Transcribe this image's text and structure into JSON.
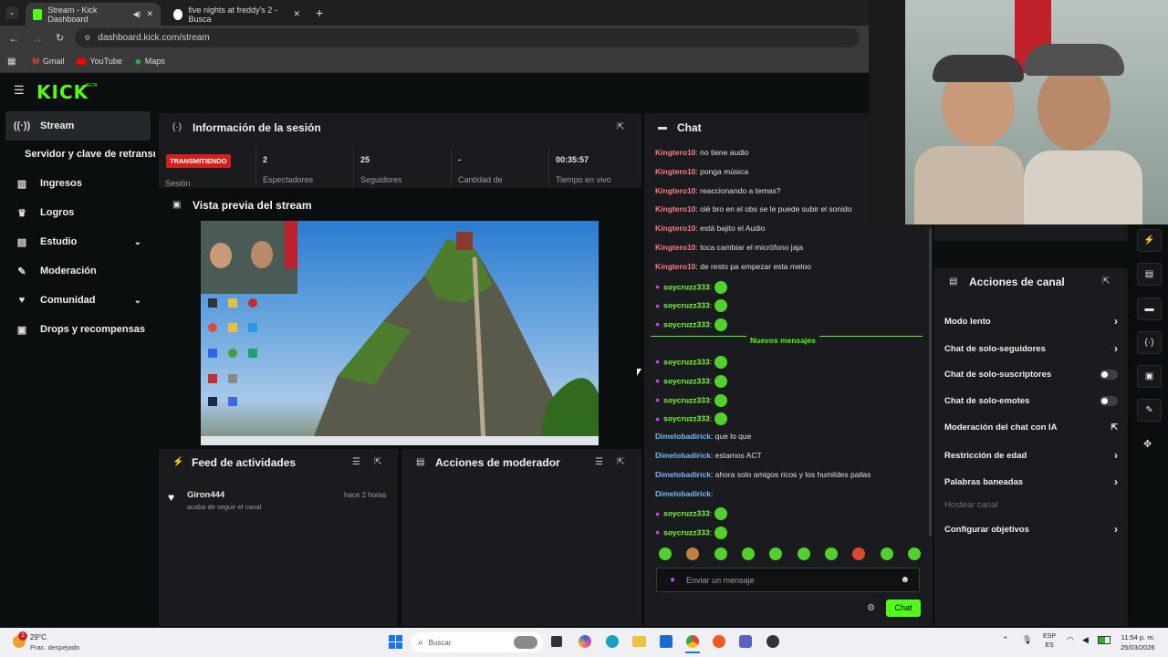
{
  "browser": {
    "tabs": [
      {
        "title": "Stream - Kick Dashboard",
        "active": true
      },
      {
        "title": "five nights at freddy's 2 - Busca",
        "active": false
      }
    ],
    "url": "dashboard.kick.com/stream",
    "bookmarks": [
      "Gmail",
      "YouTube",
      "Maps"
    ]
  },
  "app": {
    "logo": "KICK",
    "logo_badge": "BETA"
  },
  "sidebar": {
    "items": [
      {
        "label": "Stream",
        "icon": "radio-icon"
      },
      {
        "label": "Servidor y clave de retransmisión",
        "icon": ""
      },
      {
        "label": "Ingresos",
        "icon": "chart-icon"
      },
      {
        "label": "Logros",
        "icon": "trophy-icon"
      },
      {
        "label": "Estudio",
        "icon": "layout-icon"
      },
      {
        "label": "Moderación",
        "icon": "wrench-icon"
      },
      {
        "label": "Comunidad",
        "icon": "heart-icon"
      },
      {
        "label": "Drops y recompensas",
        "icon": "gift-icon"
      }
    ]
  },
  "session": {
    "title": "Información de la sesión",
    "status_badge": "TRANSMITIENDO",
    "status_label": "Sesión",
    "stats": [
      {
        "value": "2",
        "label": "Espectadores"
      },
      {
        "value": "25",
        "label": "Seguidores"
      },
      {
        "value": "-",
        "label": "Cantidad de"
      },
      {
        "value": "00:35:57",
        "label": "Tiempo en vivo"
      }
    ]
  },
  "preview": {
    "title": "Vista previa del stream"
  },
  "feed": {
    "title": "Feed de actividades",
    "items": [
      {
        "user": "Giron444",
        "text": "acaba de seguir el canal",
        "time": "hace 2 horas"
      }
    ]
  },
  "modactions": {
    "title": "Acciones de moderador"
  },
  "chat": {
    "title": "Chat",
    "messages": [
      {
        "user": "Kingtero10",
        "kind": "kn",
        "text": ": no tiene audio"
      },
      {
        "user": "Kingtero10",
        "kind": "kn",
        "text": ": ponga música"
      },
      {
        "user": "Kingtero10",
        "kind": "kn",
        "text": ": reaccionando a temas?"
      },
      {
        "user": "Kingtero10",
        "kind": "kn",
        "text": ": olé bro en el obs se le puede subir el sonido"
      },
      {
        "user": "Kingtero10",
        "kind": "kn",
        "text": ": está bajito el Audio"
      },
      {
        "user": "Kingtero10",
        "kind": "kn",
        "text": ": toca cambiar el micrófono jaja"
      },
      {
        "user": "Kingtero10",
        "kind": "kn",
        "text": ": de resto pa empezar esta meloo"
      },
      {
        "user": "soycruzz333",
        "kind": "sy",
        "text": ":"
      },
      {
        "user": "soycruzz333",
        "kind": "sy",
        "text": ":"
      },
      {
        "user": "soycruzz333",
        "kind": "sy",
        "text": ":"
      }
    ],
    "new_messages_label": "Nuevos mensajes",
    "messages2": [
      {
        "user": "soycruzz333",
        "kind": "sy",
        "text": ":"
      },
      {
        "user": "soycruzz333",
        "kind": "sy",
        "text": ":"
      },
      {
        "user": "soycruzz333",
        "kind": "sy",
        "text": ":"
      },
      {
        "user": "soycruzz333",
        "kind": "sy",
        "text": ":"
      },
      {
        "user": "Dimelobadirick",
        "kind": "dm",
        "text": ": que lo que"
      },
      {
        "user": "Dimelobadirick",
        "kind": "dm",
        "text": ": estamos ACT"
      },
      {
        "user": "Dimelobadirick",
        "kind": "dm",
        "text": ": ahora solo amigos ricos y los humildes pailas"
      },
      {
        "user": "Dimelobadirick",
        "kind": "dm",
        "text": ":"
      },
      {
        "user": "soycruzz333",
        "kind": "sy",
        "text": ":"
      },
      {
        "user": "soycruzz333",
        "kind": "sy",
        "text": ":"
      }
    ],
    "input_placeholder": "Enviar un mensaje",
    "send_label": "Chat"
  },
  "channel_actions": {
    "title": "Acciones de canal",
    "items": [
      {
        "label": "Modo lento",
        "control": "chevron"
      },
      {
        "label": "Chat de solo-seguidores",
        "control": "chevron"
      },
      {
        "label": "Chat de solo-suscriptores",
        "control": "toggle"
      },
      {
        "label": "Chat de solo-emotes",
        "control": "toggle"
      },
      {
        "label": "Moderación del chat con IA",
        "control": "external"
      },
      {
        "label": "Restricción de edad",
        "control": "chevron"
      },
      {
        "label": "Palabras baneadas",
        "control": "chevron"
      },
      {
        "label": "Hostear canal",
        "control": "none",
        "disabled": true
      },
      {
        "label": "Configurar objetivos",
        "control": "chevron"
      }
    ]
  },
  "taskbar": {
    "weather_temp": "29°C",
    "weather_text": "Prac. despejado",
    "weather_badge": "2",
    "search_placeholder": "Buscar",
    "lang_top": "ESP",
    "lang_bottom": "ES",
    "time": "11:54 p. m.",
    "date": "25/03/2026"
  },
  "colors": {
    "accent": "#53fc18",
    "live": "#d41f1f",
    "panel": "#191b1f",
    "bg": "#0b0e0f"
  }
}
